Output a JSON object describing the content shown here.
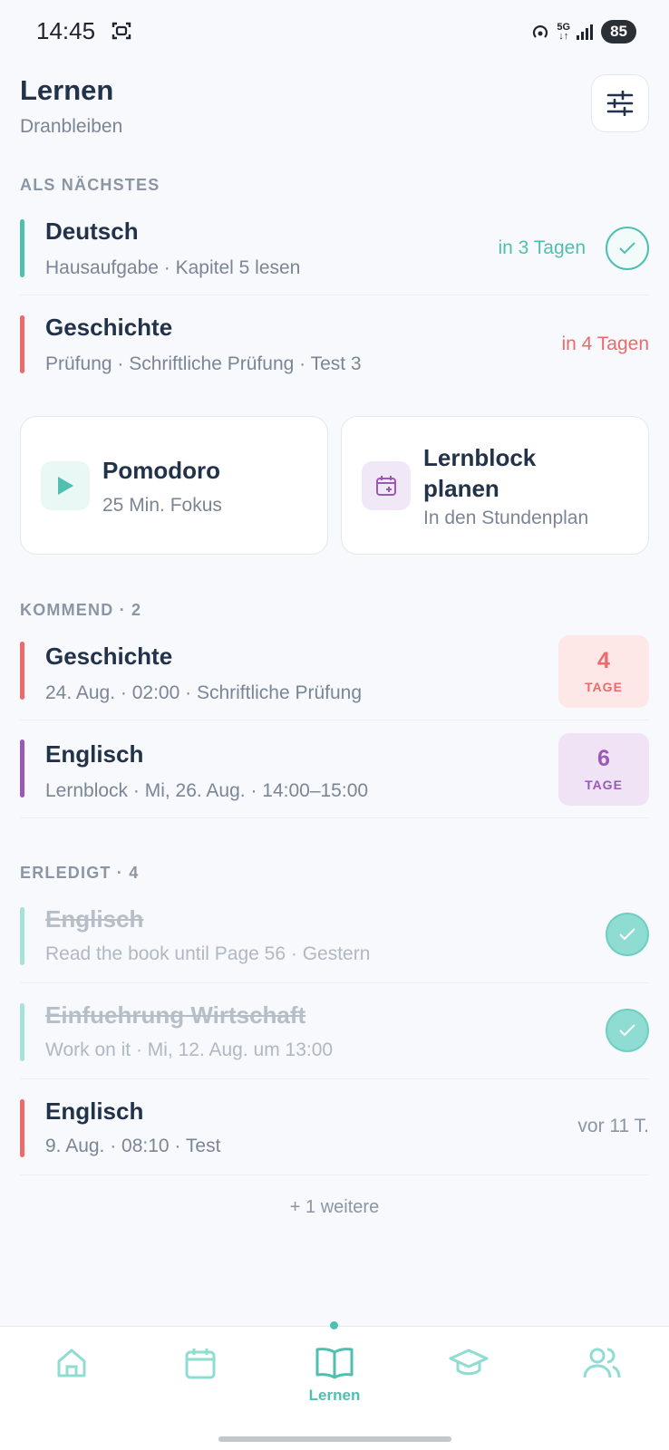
{
  "status": {
    "time": "14:45",
    "battery": "85",
    "network": "5G"
  },
  "header": {
    "title": "Lernen",
    "subtitle": "Dranbleiben"
  },
  "colors": {
    "teal": "#4fbfb0",
    "red": "#ec6a6a",
    "purple": "#9b59b6"
  },
  "next": {
    "label": "ALS NÄCHSTES",
    "items": [
      {
        "title": "Deutsch",
        "sub": "Hausaufgabe · Kapitel 5 lesen",
        "due": "in 3 Tagen"
      },
      {
        "title": "Geschichte",
        "sub": "Prüfung · Schriftliche Prüfung · Test 3",
        "due": "in 4 Tagen"
      }
    ]
  },
  "cards": {
    "pomodoro": {
      "title": "Pomodoro",
      "sub": "25 Min. Fokus"
    },
    "lernblock": {
      "title_line1": "Lernblock",
      "title_line2": "planen",
      "sub": "In den Stundenplan"
    }
  },
  "upcoming": {
    "label": "KOMMEND · 2",
    "items": [
      {
        "title": "Geschichte",
        "sub": "24. Aug. · 02:00 · Schriftliche Prüfung",
        "days": "4",
        "days_label": "TAGE"
      },
      {
        "title": "Englisch",
        "sub": "Lernblock · Mi, 26. Aug. · 14:00–15:00",
        "days": "6",
        "days_label": "TAGE"
      }
    ]
  },
  "done": {
    "label": "ERLEDIGT · 4",
    "items": [
      {
        "title": "Englisch",
        "sub": "Read the book until Page 56 · Gestern"
      },
      {
        "title": "Einfuehrung Wirtschaft",
        "sub": "Work on it · Mi, 12. Aug. um 13:00"
      },
      {
        "title": "Englisch",
        "sub": "9. Aug. · 08:10 · Test",
        "ago": "vor 11 T."
      }
    ],
    "more": "+ 1 weitere"
  },
  "nav": {
    "items": [
      {
        "icon": "home-icon"
      },
      {
        "icon": "calendar-icon"
      },
      {
        "icon": "book-icon",
        "label": "Lernen",
        "active": true
      },
      {
        "icon": "graduation-cap-icon"
      },
      {
        "icon": "users-icon"
      }
    ]
  }
}
